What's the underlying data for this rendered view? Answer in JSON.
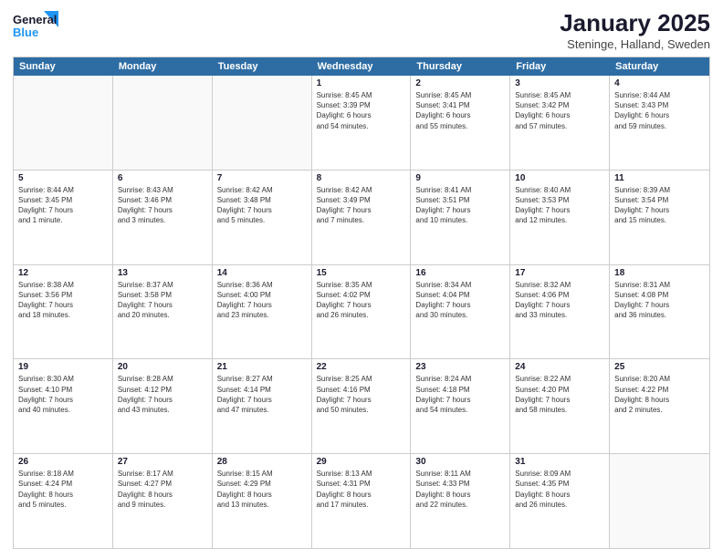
{
  "logo": {
    "text_general": "General",
    "text_blue": "Blue"
  },
  "header": {
    "month": "January 2025",
    "location": "Steninge, Halland, Sweden"
  },
  "days_of_week": [
    "Sunday",
    "Monday",
    "Tuesday",
    "Wednesday",
    "Thursday",
    "Friday",
    "Saturday"
  ],
  "weeks": [
    [
      {
        "day": "",
        "info": ""
      },
      {
        "day": "",
        "info": ""
      },
      {
        "day": "",
        "info": ""
      },
      {
        "day": "1",
        "info": "Sunrise: 8:45 AM\nSunset: 3:39 PM\nDaylight: 6 hours\nand 54 minutes."
      },
      {
        "day": "2",
        "info": "Sunrise: 8:45 AM\nSunset: 3:41 PM\nDaylight: 6 hours\nand 55 minutes."
      },
      {
        "day": "3",
        "info": "Sunrise: 8:45 AM\nSunset: 3:42 PM\nDaylight: 6 hours\nand 57 minutes."
      },
      {
        "day": "4",
        "info": "Sunrise: 8:44 AM\nSunset: 3:43 PM\nDaylight: 6 hours\nand 59 minutes."
      }
    ],
    [
      {
        "day": "5",
        "info": "Sunrise: 8:44 AM\nSunset: 3:45 PM\nDaylight: 7 hours\nand 1 minute."
      },
      {
        "day": "6",
        "info": "Sunrise: 8:43 AM\nSunset: 3:46 PM\nDaylight: 7 hours\nand 3 minutes."
      },
      {
        "day": "7",
        "info": "Sunrise: 8:42 AM\nSunset: 3:48 PM\nDaylight: 7 hours\nand 5 minutes."
      },
      {
        "day": "8",
        "info": "Sunrise: 8:42 AM\nSunset: 3:49 PM\nDaylight: 7 hours\nand 7 minutes."
      },
      {
        "day": "9",
        "info": "Sunrise: 8:41 AM\nSunset: 3:51 PM\nDaylight: 7 hours\nand 10 minutes."
      },
      {
        "day": "10",
        "info": "Sunrise: 8:40 AM\nSunset: 3:53 PM\nDaylight: 7 hours\nand 12 minutes."
      },
      {
        "day": "11",
        "info": "Sunrise: 8:39 AM\nSunset: 3:54 PM\nDaylight: 7 hours\nand 15 minutes."
      }
    ],
    [
      {
        "day": "12",
        "info": "Sunrise: 8:38 AM\nSunset: 3:56 PM\nDaylight: 7 hours\nand 18 minutes."
      },
      {
        "day": "13",
        "info": "Sunrise: 8:37 AM\nSunset: 3:58 PM\nDaylight: 7 hours\nand 20 minutes."
      },
      {
        "day": "14",
        "info": "Sunrise: 8:36 AM\nSunset: 4:00 PM\nDaylight: 7 hours\nand 23 minutes."
      },
      {
        "day": "15",
        "info": "Sunrise: 8:35 AM\nSunset: 4:02 PM\nDaylight: 7 hours\nand 26 minutes."
      },
      {
        "day": "16",
        "info": "Sunrise: 8:34 AM\nSunset: 4:04 PM\nDaylight: 7 hours\nand 30 minutes."
      },
      {
        "day": "17",
        "info": "Sunrise: 8:32 AM\nSunset: 4:06 PM\nDaylight: 7 hours\nand 33 minutes."
      },
      {
        "day": "18",
        "info": "Sunrise: 8:31 AM\nSunset: 4:08 PM\nDaylight: 7 hours\nand 36 minutes."
      }
    ],
    [
      {
        "day": "19",
        "info": "Sunrise: 8:30 AM\nSunset: 4:10 PM\nDaylight: 7 hours\nand 40 minutes."
      },
      {
        "day": "20",
        "info": "Sunrise: 8:28 AM\nSunset: 4:12 PM\nDaylight: 7 hours\nand 43 minutes."
      },
      {
        "day": "21",
        "info": "Sunrise: 8:27 AM\nSunset: 4:14 PM\nDaylight: 7 hours\nand 47 minutes."
      },
      {
        "day": "22",
        "info": "Sunrise: 8:25 AM\nSunset: 4:16 PM\nDaylight: 7 hours\nand 50 minutes."
      },
      {
        "day": "23",
        "info": "Sunrise: 8:24 AM\nSunset: 4:18 PM\nDaylight: 7 hours\nand 54 minutes."
      },
      {
        "day": "24",
        "info": "Sunrise: 8:22 AM\nSunset: 4:20 PM\nDaylight: 7 hours\nand 58 minutes."
      },
      {
        "day": "25",
        "info": "Sunrise: 8:20 AM\nSunset: 4:22 PM\nDaylight: 8 hours\nand 2 minutes."
      }
    ],
    [
      {
        "day": "26",
        "info": "Sunrise: 8:18 AM\nSunset: 4:24 PM\nDaylight: 8 hours\nand 5 minutes."
      },
      {
        "day": "27",
        "info": "Sunrise: 8:17 AM\nSunset: 4:27 PM\nDaylight: 8 hours\nand 9 minutes."
      },
      {
        "day": "28",
        "info": "Sunrise: 8:15 AM\nSunset: 4:29 PM\nDaylight: 8 hours\nand 13 minutes."
      },
      {
        "day": "29",
        "info": "Sunrise: 8:13 AM\nSunset: 4:31 PM\nDaylight: 8 hours\nand 17 minutes."
      },
      {
        "day": "30",
        "info": "Sunrise: 8:11 AM\nSunset: 4:33 PM\nDaylight: 8 hours\nand 22 minutes."
      },
      {
        "day": "31",
        "info": "Sunrise: 8:09 AM\nSunset: 4:35 PM\nDaylight: 8 hours\nand 26 minutes."
      },
      {
        "day": "",
        "info": ""
      }
    ]
  ]
}
